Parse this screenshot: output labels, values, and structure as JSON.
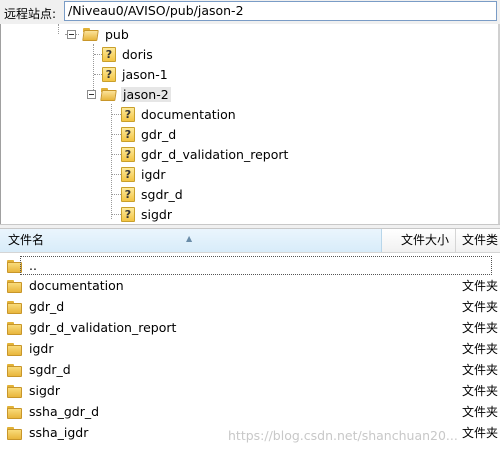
{
  "pathbar": {
    "label": "远程站点:",
    "path": "/Niveau0/AVISO/pub/jason-2"
  },
  "tree": {
    "pub": "pub",
    "doris": "doris",
    "jason1": "jason-1",
    "jason2": "jason-2",
    "children": [
      "documentation",
      "gdr_d",
      "gdr_d_validation_report",
      "igdr",
      "sgdr_d",
      "sigdr"
    ]
  },
  "list": {
    "headers": {
      "name": "文件名",
      "size": "文件大小",
      "type": "文件类"
    },
    "parent_row": "..",
    "rows": [
      {
        "name": "documentation",
        "type": "文件夹"
      },
      {
        "name": "gdr_d",
        "type": "文件夹"
      },
      {
        "name": "gdr_d_validation_report",
        "type": "文件夹"
      },
      {
        "name": "igdr",
        "type": "文件夹"
      },
      {
        "name": "sgdr_d",
        "type": "文件夹"
      },
      {
        "name": "sigdr",
        "type": "文件夹"
      },
      {
        "name": "ssha_gdr_d",
        "type": "文件夹"
      },
      {
        "name": "ssha_igdr",
        "type": "文件夹"
      }
    ]
  },
  "watermark": "https://blog.csdn.net/shanchuan20..."
}
